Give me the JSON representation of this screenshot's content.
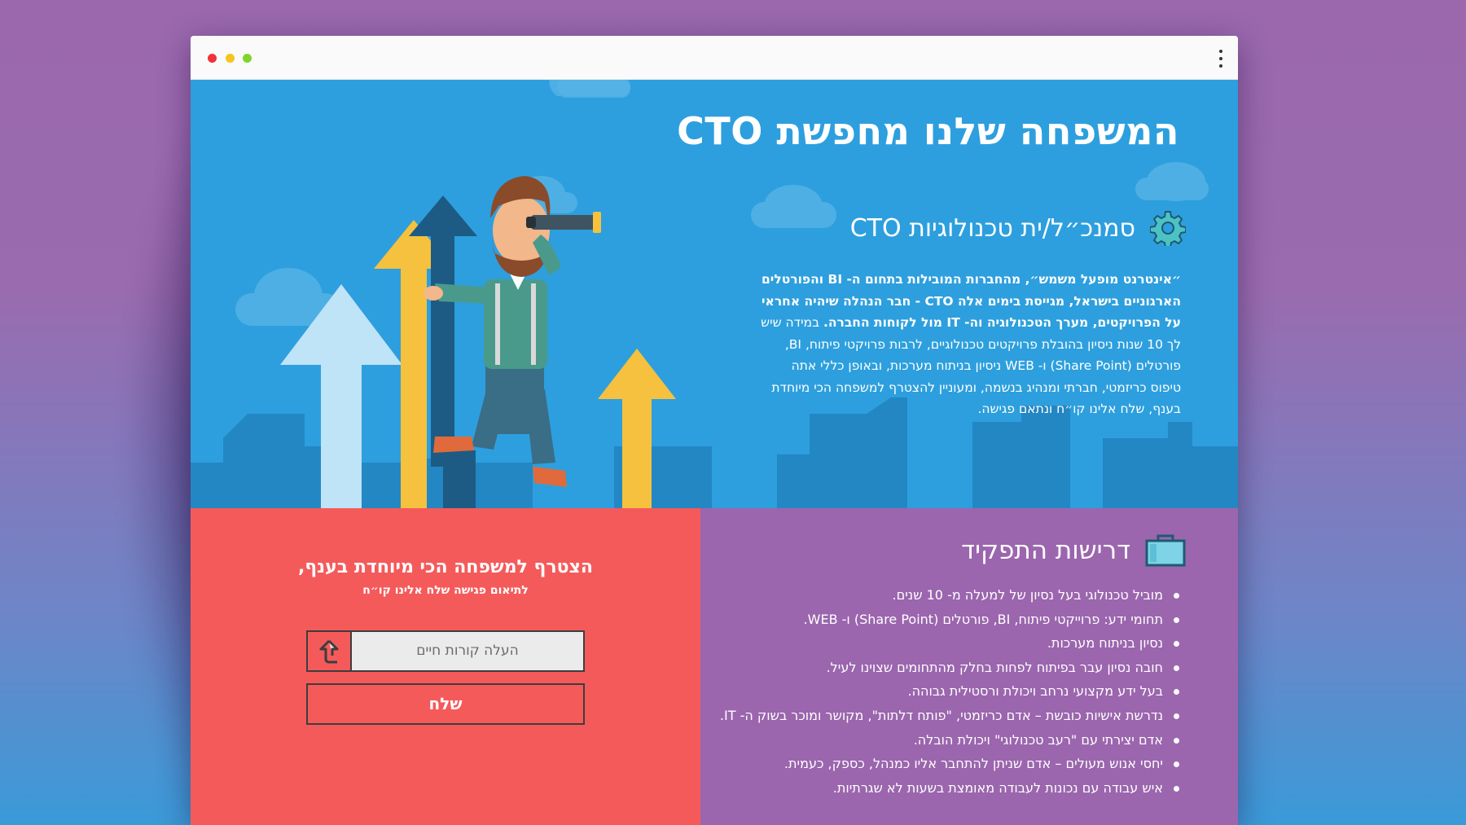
{
  "window": {
    "controls": [
      "close",
      "minimize",
      "maximize"
    ],
    "menu_icon": "kebab-menu-icon"
  },
  "hero": {
    "title": "המשפחה שלנו מחפשת CTO",
    "role_title": "סמנכ״ל/ית טכנולוגיות CTO",
    "role_icon": "gear-icon",
    "description_bold": "״אינטרנט מופעל משמש״, מהחברות המובילות בתחום ה- BI והפורטלים הארגוניים בישראל, מגייסת בימים אלה CTO - חבר הנהלה שיהיה אחראי על הפרויקטים, מערך הטכנולוגיה וה- IT מול לקוחות החברה.",
    "description_rest": "במידה שיש לך 10 שנות ניסיון בהובלת פרויקטים טכנולוגיים, לרבות פרויקטי פיתוח, BI, פורטלים (Share Point) ו- WEB ניסיון בניתוח מערכות, ובאופן כללי אתה טיפוס כריזמטי, חברתי ומנהיג בנשמה, ומעוניין להצטרף למשפחה הכי מיוחדת בענף, שלח אלינו קו״ח ונתאם פגישה.",
    "colors": {
      "sky": "#2d9fde",
      "arrow_yellow": "#f5c13e",
      "arrow_light": "#bfe3f7",
      "arrow_dark": "#1d5b84"
    }
  },
  "form": {
    "title": "הצטרף למשפחה הכי מיוחדת בענף,",
    "subtitle": "לתיאום פגישה שלח אלינו קו״ח",
    "upload_placeholder": "העלה קורות חיים",
    "upload_icon": "upload-arrow-icon",
    "send_label": "שלח",
    "background": "#f55a5b"
  },
  "requirements": {
    "title": "דרישות התפקיד",
    "icon": "briefcase-icon",
    "background": "#9b66ae",
    "items": [
      "מוביל טכנולוגי בעל נסיון של למעלה מ- 10 שנים.",
      "תחומי ידע: פרוייקטי פיתוח, BI, פורטלים (Share Point) ו- WEB.",
      "נסיון בניתוח מערכות.",
      "חובה נסיון עבר בפיתוח לפחות בחלק מהתחומים שצוינו לעיל.",
      "בעל ידע מקצועי נרחב ויכולת ורסטילית גבוהה.",
      "נדרשת אישיות כובשת – אדם כריזמטי, \"פותח דלתות\", מקושר ומוכר בשוק ה- IT.",
      "אדם יצירתי עם \"רעב טכנולוגי\" ויכולת הובלה.",
      "יחסי אנוש מעולים – אדם שניתן להתחבר אליו כמנהל, כספק, כעמית.",
      "איש עבודה עם נכונות לעבודה מאומצת בשעות לא שגרתיות."
    ]
  }
}
